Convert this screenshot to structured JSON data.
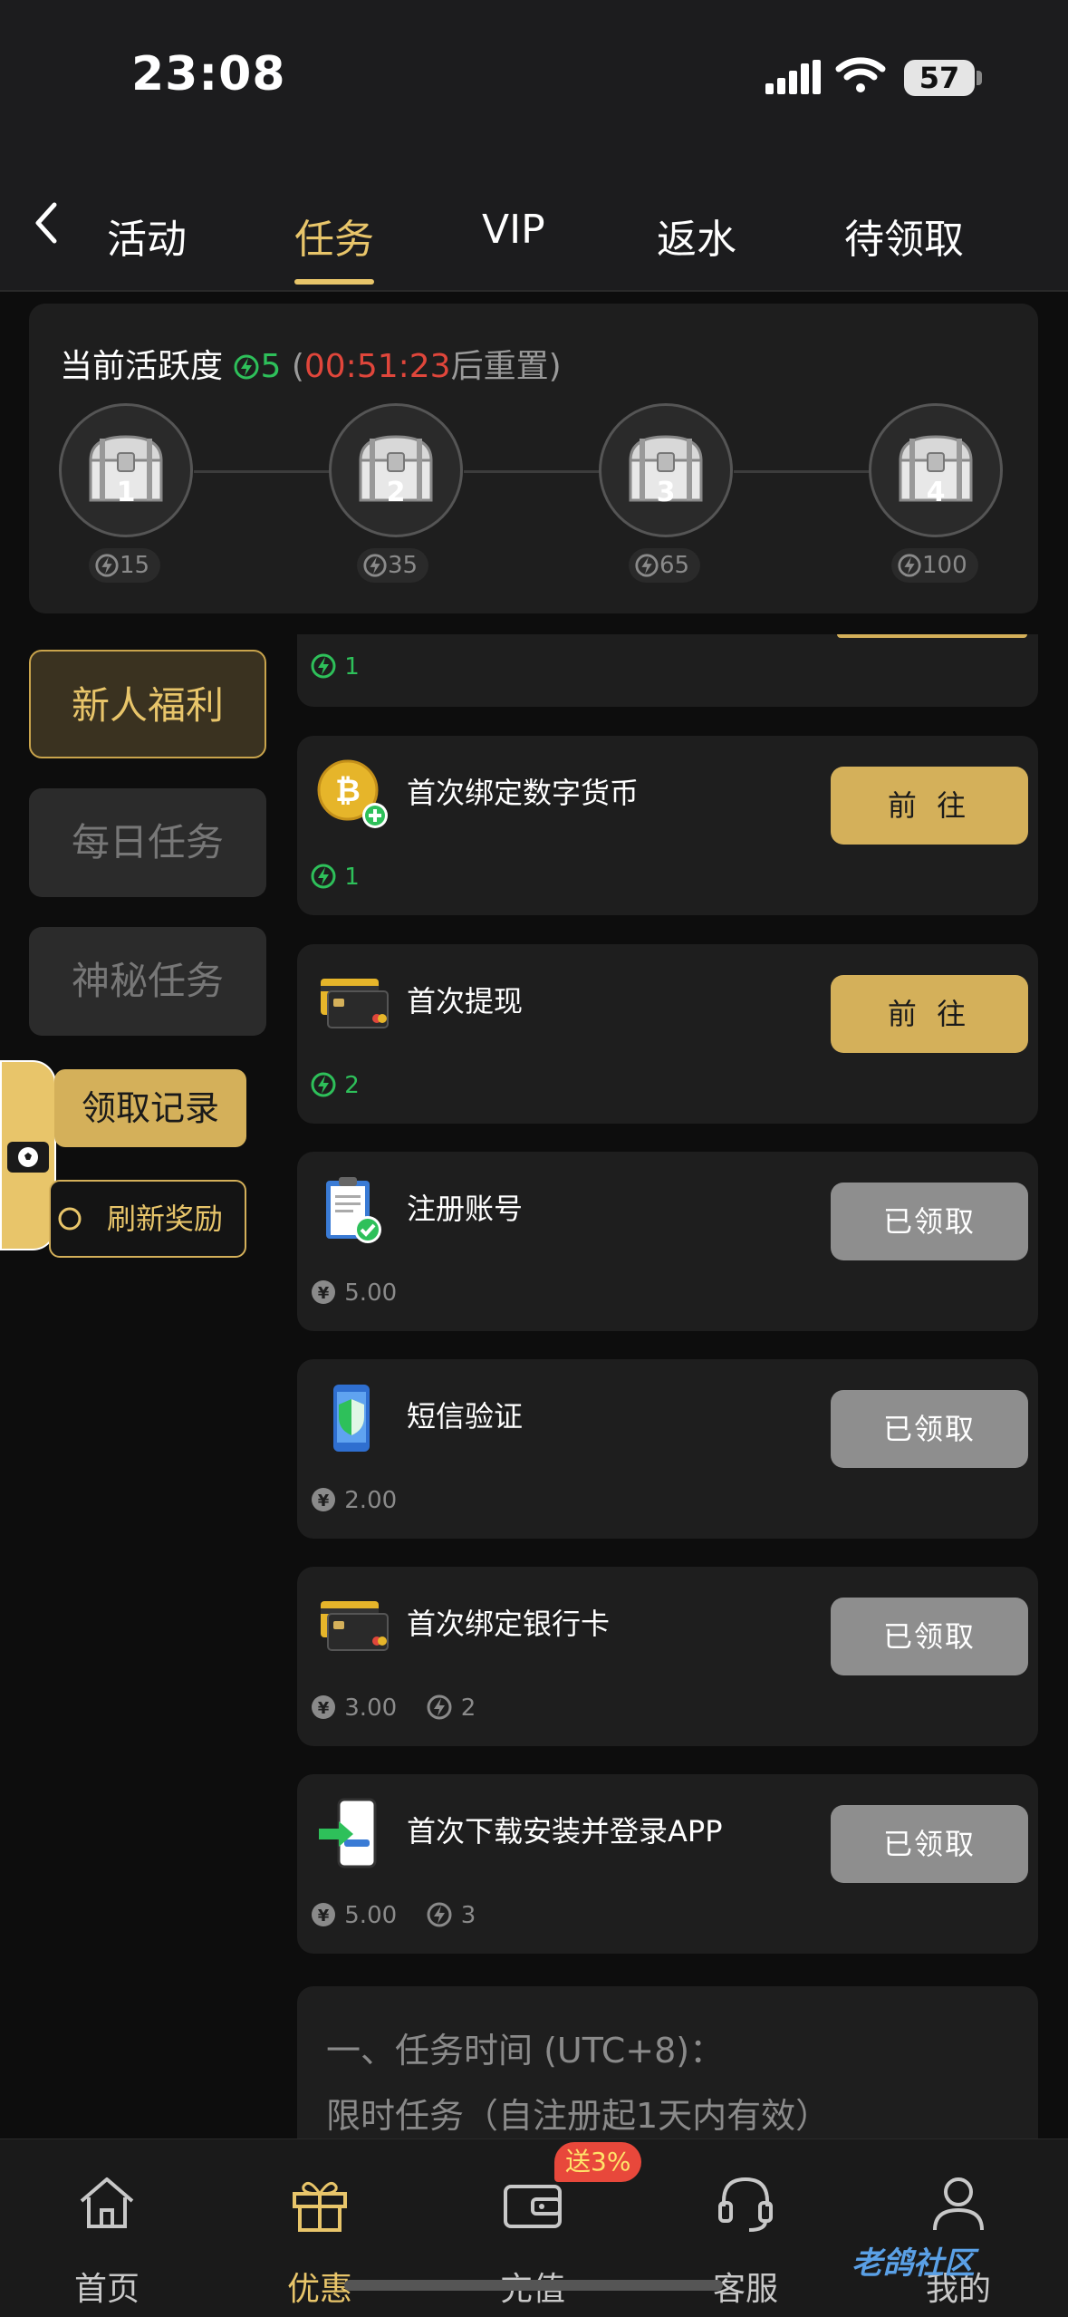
{
  "status_bar": {
    "time": "23:08",
    "battery": "57"
  },
  "top_nav": {
    "tabs": [
      {
        "label": "活动"
      },
      {
        "label": "任务"
      },
      {
        "label": "VIP"
      },
      {
        "label": "返水"
      },
      {
        "label": "待领取"
      }
    ],
    "active_tab": "任务"
  },
  "activity": {
    "title": "当前活跃度",
    "value": "5",
    "paren_open": "(",
    "countdown": "00:51:23",
    "reset_text": "后重置",
    "paren_close": ")",
    "chests": [
      {
        "num": "1",
        "points": "15"
      },
      {
        "num": "2",
        "points": "35"
      },
      {
        "num": "3",
        "points": "65"
      },
      {
        "num": "4",
        "points": "100"
      }
    ]
  },
  "side_menu": {
    "items": [
      {
        "label": "新人福利"
      },
      {
        "label": "每日任务"
      },
      {
        "label": "神秘任务"
      }
    ],
    "record_button": "领取记录",
    "refresh_button": "刷新奖励"
  },
  "tasks": [
    {
      "title": "",
      "button": "",
      "energy": "1",
      "cash": ""
    },
    {
      "title": "首次绑定数字货币",
      "button": "前 往",
      "energy": "1",
      "cash": ""
    },
    {
      "title": "首次提现",
      "button": "前 往",
      "energy": "2",
      "cash": ""
    },
    {
      "title": "注册账号",
      "button": "已领取",
      "energy": "",
      "cash": "5.00"
    },
    {
      "title": "短信验证",
      "button": "已领取",
      "energy": "",
      "cash": "2.00"
    },
    {
      "title": "首次绑定银行卡",
      "button": "已领取",
      "energy": "2",
      "cash": "3.00"
    },
    {
      "title": "首次下载安装并登录APP",
      "button": "已领取",
      "energy": "3",
      "cash": "5.00"
    }
  ],
  "rules": {
    "line1": "一、任务时间 (UTC+8)：",
    "line2": "限时任务（自注册起1天内有效）"
  },
  "bottom_nav": {
    "items": [
      {
        "label": "首页",
        "icon": "home-icon"
      },
      {
        "label": "优惠",
        "icon": "gift-icon"
      },
      {
        "label": "充值",
        "icon": "wallet-icon"
      },
      {
        "label": "客服",
        "icon": "headset-icon"
      },
      {
        "label": "我的",
        "icon": "user-icon"
      }
    ],
    "active": "优惠",
    "promo_badge": "送3%"
  },
  "watermark": "老鸽社区",
  "colors": {
    "gold": "#e8c56a",
    "green": "#2ec05a",
    "red": "#e0463b",
    "card": "#1e1e1e"
  }
}
